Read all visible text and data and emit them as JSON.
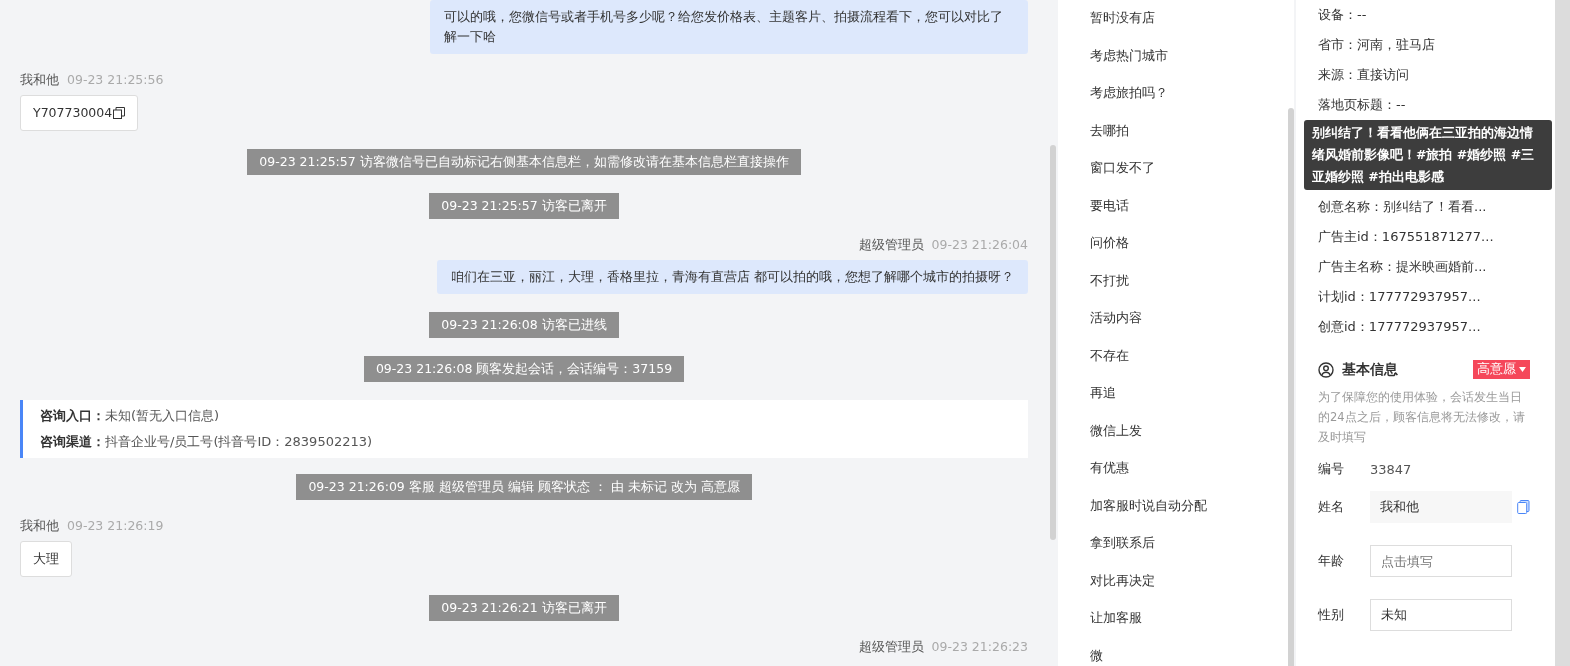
{
  "chat": [
    {
      "kind": "agent",
      "text": "可以的哦，您微信号或者手机号多少呢？给您发价格表、主题客片、拍摄流程看下，您可以对比了解一下哈"
    },
    {
      "kind": "visitor",
      "name": "我和他",
      "time": "09-23 21:25:56",
      "text": "Y707730004",
      "copy": true
    },
    {
      "kind": "system",
      "text": "09-23 21:25:57 访客微信号已自动标记右侧基本信息栏，如需修改请在基本信息栏直接操作"
    },
    {
      "kind": "system",
      "text": "09-23 21:25:57 访客已离开"
    },
    {
      "kind": "agent",
      "name": "超级管理员",
      "time": "09-23 21:26:04",
      "text": "咱们在三亚，丽江，大理，香格里拉，青海有直营店 都可以拍的哦，您想了解哪个城市的拍摄呀？"
    },
    {
      "kind": "system",
      "text": "09-23 21:26:08 访客已进线"
    },
    {
      "kind": "system",
      "text": "09-23 21:26:08 顾客发起会话，会话编号：37159"
    },
    {
      "kind": "info",
      "lines": [
        {
          "label": "咨询入口：",
          "value": "未知(暂无入口信息)"
        },
        {
          "label": "咨询渠道：",
          "value": "抖音企业号/员工号(抖音号ID：2839502213)"
        }
      ]
    },
    {
      "kind": "system",
      "text": "09-23 21:26:09 客服 超级管理员 编辑 顾客状态 ： 由 未标记 改为 高意愿"
    },
    {
      "kind": "visitor",
      "name": "我和他",
      "time": "09-23 21:26:19",
      "text": "大理",
      "copy": false
    },
    {
      "kind": "system",
      "text": "09-23 21:26:21 访客已离开"
    },
    {
      "kind": "header",
      "name": "超级管理员",
      "time": "09-23 21:26:23"
    }
  ],
  "quick_replies": [
    "暂时没有店",
    "考虑热门城市",
    "考虑旅拍吗？",
    "去哪拍",
    "窗口发不了",
    "要电话",
    "问价格",
    "不打扰",
    "活动内容",
    "不存在",
    "再追",
    "微信上发",
    "有优惠",
    "加客服时说自动分配",
    "拿到联系后",
    "对比再决定",
    "让加客服",
    "微"
  ],
  "source_info": [
    "设备：--",
    "省市：河南，驻马店",
    "来源：直接访问",
    "落地页标题：--"
  ],
  "ad_info": [
    "创意名称：别纠结了！看看...",
    "广告主id：167551871277...",
    "广告主名称：提米映画婚前...",
    "计划id：177772937957...",
    "创意id：177772937957..."
  ],
  "tooltip": "别纠结了！看看他俩在三亚拍的海边情绪风婚前影像吧！#旅拍 #婚纱照 #三亚婚纱照 #拍出电影感",
  "basic_info": {
    "title": "基本信息",
    "status": "高意愿",
    "note": "为了保障您的使用体验，会话发生当日的24点之后，顾客信息将无法修改，请及时填写",
    "fields": [
      {
        "kind": "display",
        "label": "编号",
        "value": "33847"
      },
      {
        "kind": "filled",
        "label": "姓名",
        "value": "我和他"
      },
      {
        "kind": "input",
        "label": "年龄",
        "placeholder": "点击填写"
      },
      {
        "kind": "box",
        "label": "性别",
        "value": "未知"
      }
    ]
  }
}
